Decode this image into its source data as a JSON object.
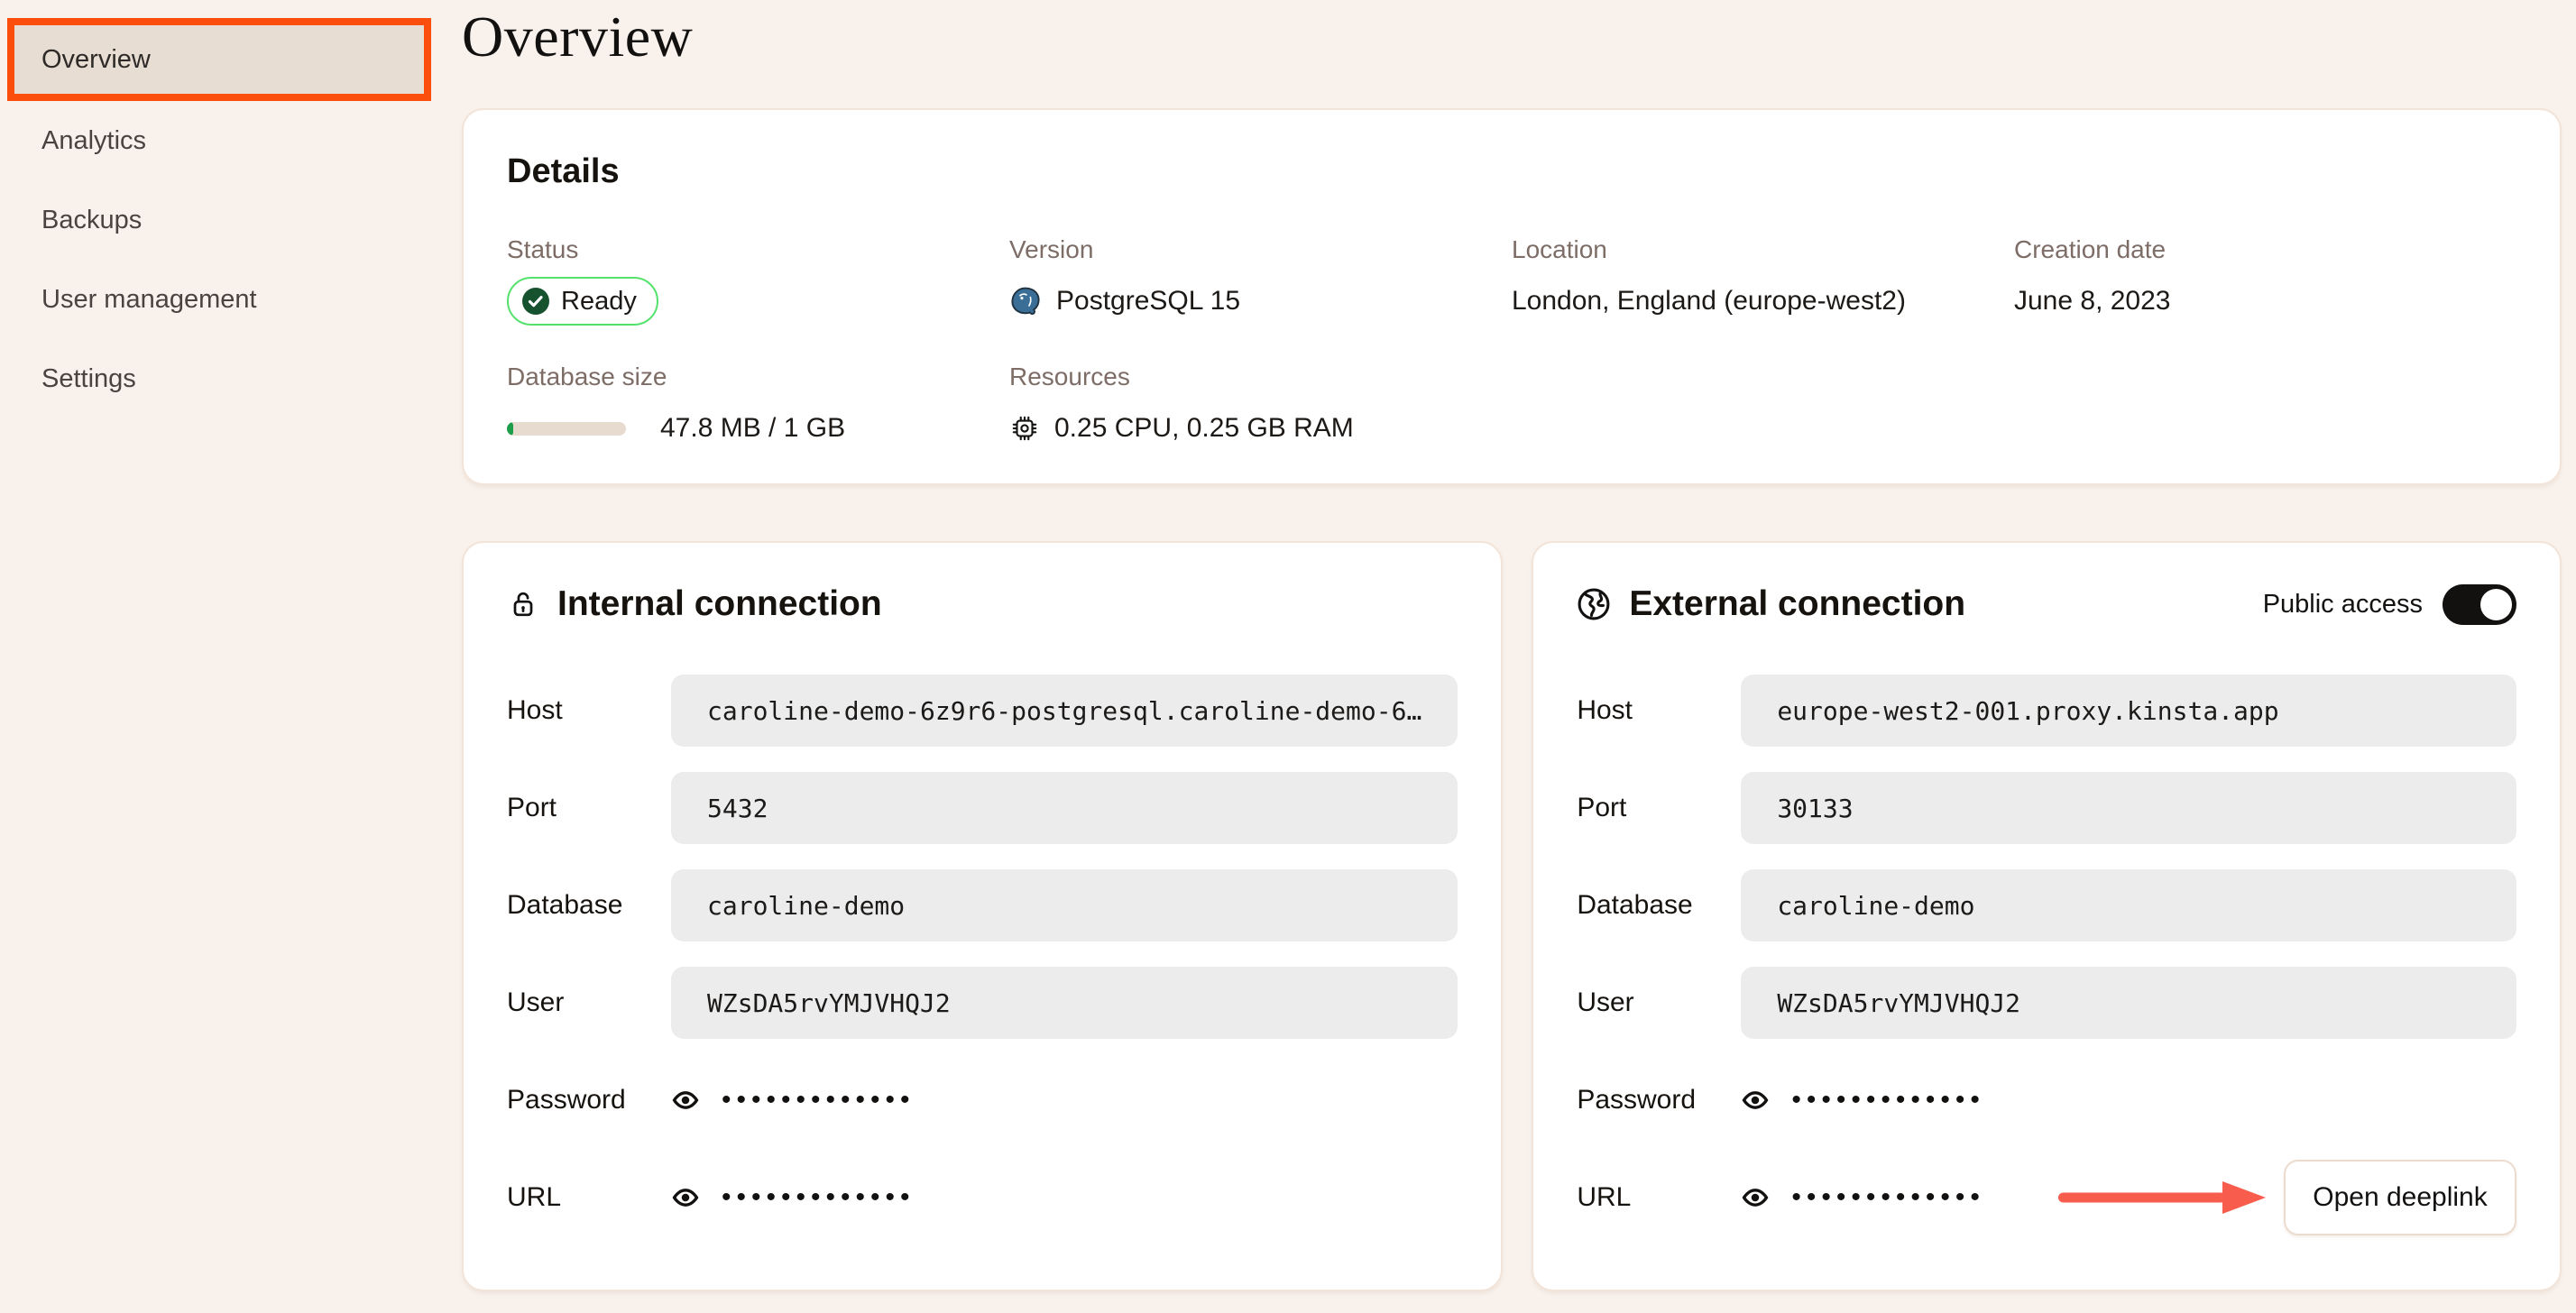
{
  "sidebar": {
    "items": [
      {
        "label": "Overview",
        "active": true
      },
      {
        "label": "Analytics",
        "active": false
      },
      {
        "label": "Backups",
        "active": false
      },
      {
        "label": "User management",
        "active": false
      },
      {
        "label": "Settings",
        "active": false
      }
    ]
  },
  "page": {
    "title": "Overview"
  },
  "details": {
    "title": "Details",
    "status": {
      "label": "Status",
      "value": "Ready"
    },
    "version": {
      "label": "Version",
      "value": "PostgreSQL 15"
    },
    "location": {
      "label": "Location",
      "value": "London, England (europe-west2)"
    },
    "creation": {
      "label": "Creation date",
      "value": "June 8, 2023"
    },
    "size": {
      "label": "Database size",
      "value": "47.8 MB / 1 GB",
      "percent_used": 5
    },
    "resources": {
      "label": "Resources",
      "value": "0.25 CPU, 0.25 GB RAM"
    }
  },
  "internal": {
    "title": "Internal connection",
    "rows": [
      {
        "label": "Host",
        "value": "caroline-demo-6z9r6-postgresql.caroline-demo-6…"
      },
      {
        "label": "Port",
        "value": "5432"
      },
      {
        "label": "Database",
        "value": "caroline-demo"
      },
      {
        "label": "User",
        "value": "WZsDA5rvYMJVHQJ2"
      },
      {
        "label": "Password",
        "value": "•••••••••••••"
      },
      {
        "label": "URL",
        "value": "•••••••••••••"
      }
    ]
  },
  "external": {
    "title": "External connection",
    "public_access_label": "Public access",
    "public_access_on": true,
    "rows": [
      {
        "label": "Host",
        "value": "europe-west2-001.proxy.kinsta.app"
      },
      {
        "label": "Port",
        "value": "30133"
      },
      {
        "label": "Database",
        "value": "caroline-demo"
      },
      {
        "label": "User",
        "value": "WZsDA5rvYMJVHQJ2"
      },
      {
        "label": "Password",
        "value": "•••••••••••••"
      },
      {
        "label": "URL",
        "value": "•••••••••••••"
      }
    ],
    "deeplink_button_label": "Open deeplink"
  },
  "colors": {
    "accent_orange": "#fb4d0c",
    "ready_border_green": "#55e26c",
    "check_circle_green": "#15522d",
    "progress_green": "#1d9e4b",
    "postgres_blue": "#3a6e96",
    "arrow_red": "#f75c4d",
    "page_background": "#f9f2ec",
    "active_item_background": "#e8ddd3"
  }
}
